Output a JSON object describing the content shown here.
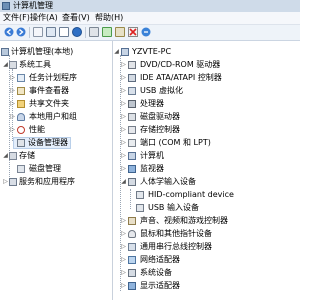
{
  "window": {
    "title": "计算机管理"
  },
  "menu": [
    "文件(F)",
    "操作(A)",
    "查看(V)",
    "帮助(H)"
  ],
  "toolbar": {
    "buttons": [
      "back-icon",
      "forward-icon",
      "up-icon",
      "show-tree-icon",
      "properties-icon",
      "help-icon",
      "computer-icon",
      "scan-hardware-icon",
      "update-driver-icon",
      "disable-icon",
      "uninstall-icon"
    ]
  },
  "left_tree": {
    "root": "计算机管理(本地)",
    "system_tools": "系统工具",
    "task_scheduler": "任务计划程序",
    "event_viewer": "事件查看器",
    "shared_folders": "共享文件夹",
    "local_users": "本地用户和组",
    "performance": "性能",
    "device_manager": "设备管理器",
    "storage": "存储",
    "disk_management": "磁盘管理",
    "services_apps": "服务和应用程序"
  },
  "device_tree": {
    "computer_name": "YZVTE-PC",
    "categories": [
      "DVD/CD-ROM 驱动器",
      "IDE ATA/ATAPI 控制器",
      "USB 虚拟化",
      "处理器",
      "磁盘驱动器",
      "存储控制器",
      "端口 (COM 和 LPT)",
      "计算机",
      "监视器",
      "人体学输入设备"
    ],
    "hid_children": [
      "HID-compliant device",
      "USB 输入设备"
    ],
    "categories_after": [
      "声音、视频和游戏控制器",
      "鼠标和其他指针设备",
      "通用串行总线控制器",
      "网络适配器",
      "系统设备",
      "显示适配器"
    ]
  },
  "colors": {
    "titlebar": "#cfdbe9",
    "selection": "#e4eefb",
    "accent": "#3d6fb0"
  }
}
